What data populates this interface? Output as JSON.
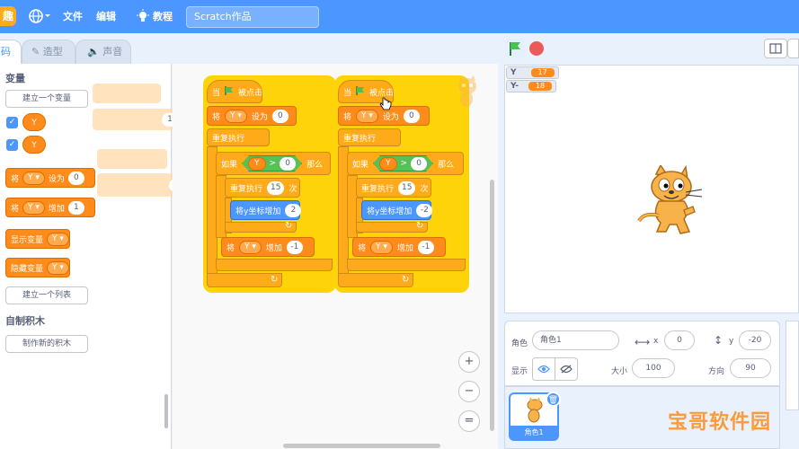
{
  "menubar": {
    "logo_text": "趣",
    "file": "文件",
    "edit": "编辑",
    "tutorials": "教程",
    "project_title": "Scratch作品"
  },
  "tabs": {
    "code": "码",
    "costumes": "造型",
    "sounds": "声音"
  },
  "palette": {
    "variables_heading": "变量",
    "make_variable": "建立一个变量",
    "var_y": "Y",
    "set_block": {
      "prefix": "将",
      "var": "Y",
      "suffix": "设为",
      "value": "0"
    },
    "change_block": {
      "prefix": "将",
      "var": "Y",
      "suffix": "增加",
      "value": "1"
    },
    "show_var": {
      "label": "显示变量",
      "var": "Y"
    },
    "hide_var": {
      "label": "隐藏变量",
      "var": "Y"
    },
    "make_list": "建立一个列表",
    "my_blocks_heading": "自制积木",
    "make_block": "制作新的积木"
  },
  "ghost_values": {
    "a": "1",
    "b": "1"
  },
  "scripts": [
    {
      "hat": {
        "prefix": "当",
        "suffix": "被点击"
      },
      "set": {
        "prefix": "将",
        "var": "Y",
        "suffix": "设为",
        "value": "0"
      },
      "forever": "重复执行",
      "if": {
        "prefix": "如果",
        "var": "Y",
        "op": ">",
        "value": "0",
        "suffix": "那么"
      },
      "repeat": {
        "prefix": "重复执行",
        "value": "15",
        "suffix": "次"
      },
      "change_y": {
        "label": "将y坐标增加",
        "value": "2"
      },
      "change": {
        "prefix": "将",
        "var": "Y",
        "suffix": "增加",
        "value": "-1"
      }
    },
    {
      "hat": {
        "prefix": "当",
        "suffix": "被点击"
      },
      "set": {
        "prefix": "将",
        "var": "Y",
        "suffix": "设为",
        "value": "0"
      },
      "forever": "重复执行",
      "if": {
        "prefix": "如果",
        "var": "Y",
        "op": ">",
        "value": "0",
        "suffix": "那么"
      },
      "repeat": {
        "prefix": "重复执行",
        "value": "15",
        "suffix": "次"
      },
      "change_y": {
        "label": "将y坐标增加",
        "value": "-2"
      },
      "change": {
        "prefix": "将",
        "var": "Y",
        "suffix": "增加",
        "value": "-1"
      }
    }
  ],
  "zoom": {
    "in": "+",
    "out": "−",
    "reset": "="
  },
  "stage": {
    "monitors": [
      {
        "name": "Y",
        "value": "17"
      },
      {
        "name": "Y-",
        "value": "18"
      }
    ]
  },
  "sprite_info": {
    "sprite_label": "角色",
    "sprite_name": "角色1",
    "x_label": "x",
    "x_value": "0",
    "y_label": "y",
    "y_value": "-20",
    "show_label": "显示",
    "size_label": "大小",
    "size_value": "100",
    "direction_label": "方向",
    "direction_value": "90"
  },
  "sprite_list": {
    "thumb_name": "角色1"
  },
  "watermark": "宝哥软件园"
}
